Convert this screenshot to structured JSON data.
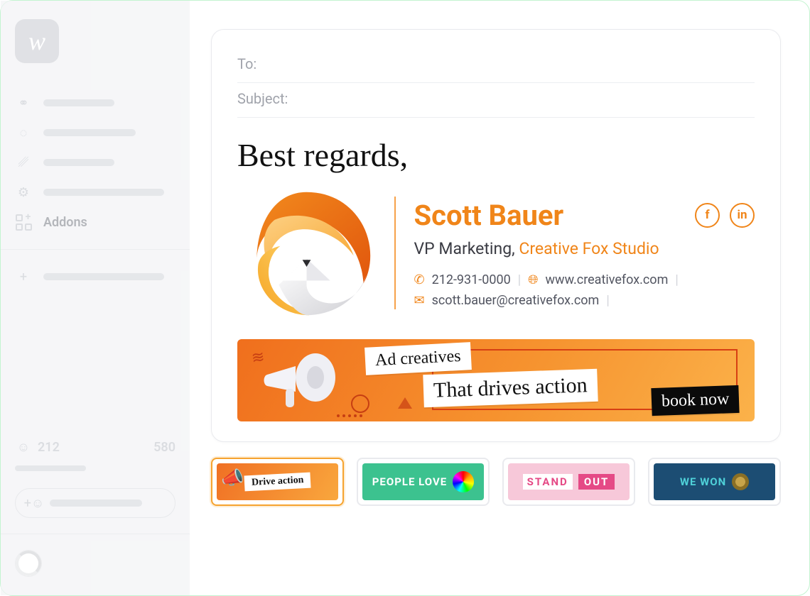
{
  "sidebar": {
    "logo_letter": "w",
    "active_label": "Addons",
    "stats": {
      "left": "212",
      "right": "580"
    }
  },
  "compose": {
    "to_label": "To:",
    "subject_label": "Subject:"
  },
  "signature": {
    "signoff": "Best regards,",
    "name": "Scott Bauer",
    "title": "VP Marketing,",
    "company": "Creative Fox Studio",
    "phone": "212-931-0000",
    "website": "www.creativefox.com",
    "email": "scott.bauer@creativefox.com",
    "social": {
      "fb": "f",
      "in": "in"
    }
  },
  "banner": {
    "line1": "Ad creatives",
    "line2": "That drives action",
    "cta": "book now"
  },
  "thumbs": [
    {
      "label": "Drive action"
    },
    {
      "label": "PEOPLE LOVE"
    },
    {
      "label1": "STAND",
      "label2": "OUT"
    },
    {
      "label": "WE WON"
    }
  ]
}
